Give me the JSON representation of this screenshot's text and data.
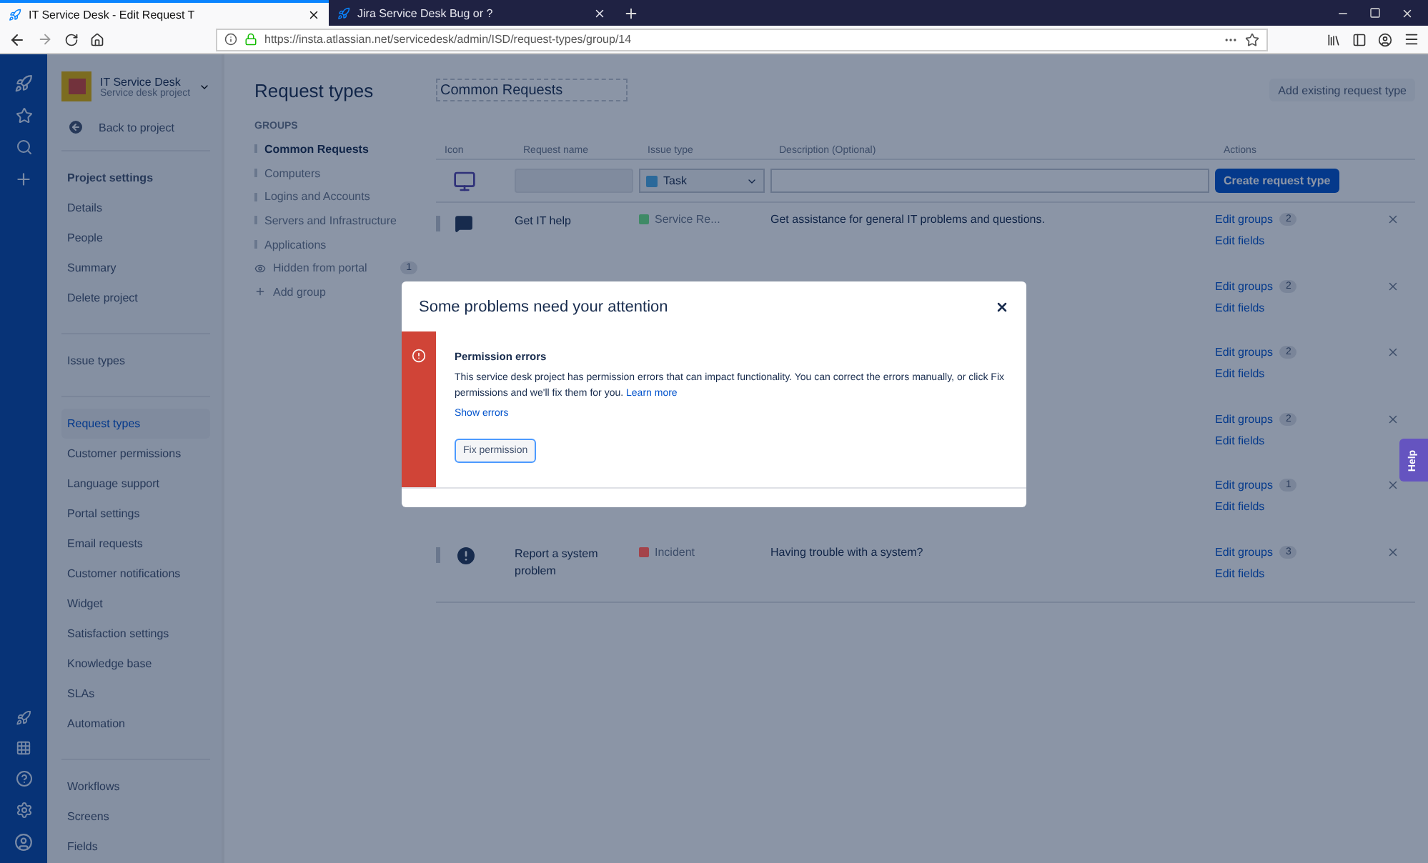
{
  "browser": {
    "tabs": [
      {
        "title": "IT Service Desk - Edit Request T",
        "selected": true
      },
      {
        "title": "Jira Service Desk Bug or ?",
        "selected": false
      }
    ],
    "url": "https://insta.atlassian.net/servicedesk/admin/ISD/request-types/group/14"
  },
  "project": {
    "name": "IT Service Desk",
    "type": "Service desk project",
    "back": "Back to project"
  },
  "sidebar": {
    "sections": [
      {
        "heading": "Project settings",
        "items": [
          {
            "label": "Details",
            "selected": false
          },
          {
            "label": "People",
            "selected": false
          },
          {
            "label": "Summary",
            "selected": false
          },
          {
            "label": "Delete project",
            "selected": false
          }
        ]
      },
      {
        "items": [
          {
            "label": "Issue types",
            "selected": false
          }
        ]
      },
      {
        "items": [
          {
            "label": "Request types",
            "selected": true
          },
          {
            "label": "Customer permissions",
            "selected": false
          },
          {
            "label": "Language support",
            "selected": false
          },
          {
            "label": "Portal settings",
            "selected": false
          },
          {
            "label": "Email requests",
            "selected": false
          },
          {
            "label": "Customer notifications",
            "selected": false
          },
          {
            "label": "Widget",
            "selected": false
          },
          {
            "label": "Satisfaction settings",
            "selected": false
          },
          {
            "label": "Knowledge base",
            "selected": false
          },
          {
            "label": "SLAs",
            "selected": false
          },
          {
            "label": "Automation",
            "selected": false
          }
        ]
      },
      {
        "items": [
          {
            "label": "Workflows",
            "selected": false
          },
          {
            "label": "Screens",
            "selected": false
          },
          {
            "label": "Fields",
            "selected": false
          }
        ]
      }
    ]
  },
  "groups": {
    "title": "Request types",
    "label": "GROUPS",
    "items": [
      {
        "label": "Common Requests",
        "selected": true
      },
      {
        "label": "Computers",
        "selected": false
      },
      {
        "label": "Logins and Accounts",
        "selected": false
      },
      {
        "label": "Servers and Infrastructure",
        "selected": false
      },
      {
        "label": "Applications",
        "selected": false
      }
    ],
    "hidden": {
      "label": "Hidden from portal",
      "count": "1"
    },
    "add": "Add group"
  },
  "main": {
    "group_name": "Common Requests",
    "add_button": "Add existing request type",
    "columns": [
      "Icon",
      "Request name",
      "Issue type",
      "Description (Optional)",
      "Actions"
    ],
    "create_row": {
      "issue_type": "Task",
      "button": "Create request type"
    },
    "rows": [
      {
        "kind": "chat",
        "name": "Get IT help",
        "issue_type": "Service Re...",
        "color": "#3f8a66",
        "description": "Get assistance for general IT problems and questions.",
        "edit_groups": "Edit groups",
        "count": "2",
        "edit_fields": "Edit fields"
      },
      {
        "edit_groups": "Edit groups",
        "count": "2",
        "edit_fields": "Edit fields"
      },
      {
        "edit_groups": "Edit groups",
        "count": "2",
        "edit_fields": "Edit fields"
      },
      {
        "edit_groups": "Edit groups",
        "count": "2",
        "edit_fields": "Edit fields"
      },
      {
        "edit_groups": "Edit groups",
        "count": "1",
        "edit_fields": "Edit fields"
      },
      {
        "kind": "alert",
        "name": "Report a system problem",
        "issue_type": "Incident",
        "color": "#a4434a",
        "description": "Having trouble with a system?",
        "edit_groups": "Edit groups",
        "count": "3",
        "edit_fields": "Edit fields"
      }
    ]
  },
  "help": "Help",
  "modal": {
    "title": "Some problems need your attention",
    "alert_title": "Permission errors",
    "text": "This service desk project has permission errors that can impact functionality. You can correct the errors manually, or click Fix permissions and we'll fix them for you.",
    "link": "Learn more",
    "show_errors": "Show errors",
    "button": "Fix permission"
  }
}
